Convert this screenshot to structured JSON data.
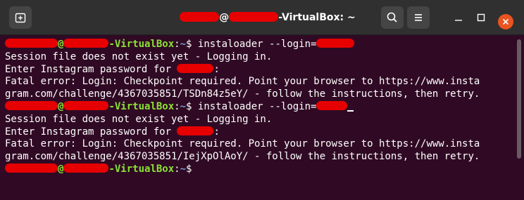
{
  "window": {
    "title_suffix": "-VirtualBox: ~",
    "title_at": "@"
  },
  "terminal": {
    "host_suffix": "-VirtualBox",
    "at": "@",
    "prompt_sep": ":",
    "path": "~",
    "prompt_char": "$",
    "lines": [
      {
        "type": "prompt",
        "command": " instaloader --login="
      },
      {
        "type": "text",
        "text": "Session file does not exist yet - Logging in."
      },
      {
        "type": "password",
        "text": "Enter Instagram password for ",
        "after": ":"
      },
      {
        "type": "text",
        "text": "Fatal error: Login: Checkpoint required. Point your browser to https://www.insta"
      },
      {
        "type": "text",
        "text": "gram.com/challenge/4367035851/TSDn84z5eY/ - follow the instructions, then retry."
      },
      {
        "type": "prompt",
        "command": " instaloader --login="
      },
      {
        "type": "text",
        "text": "Session file does not exist yet - Logging in."
      },
      {
        "type": "password",
        "text": "Enter Instagram password for ",
        "after": ":"
      },
      {
        "type": "text",
        "text": "Fatal error: Login: Checkpoint required. Point your browser to https://www.insta"
      },
      {
        "type": "text",
        "text": "gram.com/challenge/4367035851/IejXpOlAoY/ - follow the instructions, then retry."
      },
      {
        "type": "prompt",
        "command": ""
      }
    ]
  },
  "icons": {
    "new_tab": "new-tab-icon",
    "search": "search-icon",
    "menu": "hamburger-menu-icon",
    "minimize": "minimize-icon",
    "maximize": "maximize-icon",
    "close": "close-icon"
  },
  "colors": {
    "terminal_bg": "#300a24",
    "prompt_user_host": "#8ae234",
    "prompt_path": "#729fcf",
    "redaction": "#e60000",
    "close_button": "#e95420"
  }
}
